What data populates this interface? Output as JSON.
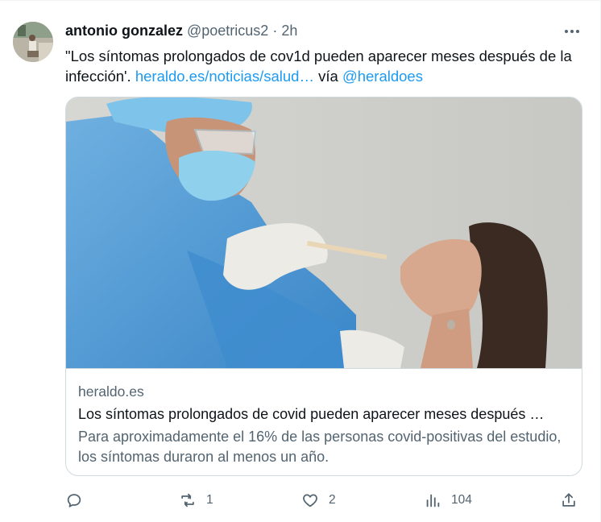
{
  "tweet": {
    "display_name": "antonio gonzalez",
    "handle": "@poetricus2",
    "separator": "·",
    "time": "2h",
    "text_prefix": "\"Los síntomas prolongados de cov1d pueden aparecer meses después de la infección'. ",
    "link_text": "heraldo.es/noticias/salud…",
    "via_text": " vía ",
    "mention": "@heraldoes"
  },
  "card": {
    "domain": "heraldo.es",
    "title": "Los síntomas prolongados de covid pueden aparecer meses después …",
    "description": "Para aproximadamente el 16% de las personas covid-positivas del estudio, los síntomas duraron al menos un año."
  },
  "actions": {
    "reply": {
      "icon": "reply-icon",
      "count": ""
    },
    "retweet": {
      "icon": "retweet-icon",
      "count": "1"
    },
    "like": {
      "icon": "heart-icon",
      "count": "2"
    },
    "views": {
      "icon": "views-icon",
      "count": "104"
    },
    "share": {
      "icon": "share-icon"
    }
  },
  "colors": {
    "text": "#0f1419",
    "secondary": "#536471",
    "link": "#1d9bf0",
    "border": "#cfd9de"
  }
}
